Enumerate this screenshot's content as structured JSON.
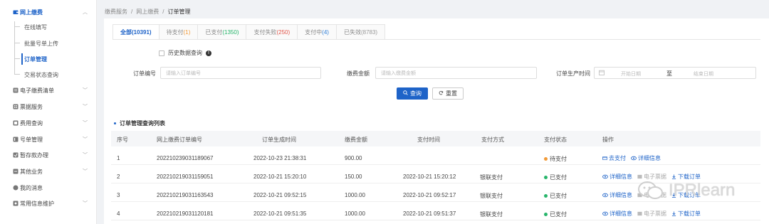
{
  "sidebar": {
    "items": [
      {
        "label": "网上缴费",
        "icon": "wallet-icon",
        "open": true
      },
      {
        "label": "电子缴费清单",
        "icon": "list-icon"
      },
      {
        "label": "票据服务",
        "icon": "receipt-icon"
      },
      {
        "label": "费用查询",
        "icon": "search-doc-icon"
      },
      {
        "label": "号单管理",
        "icon": "folder-icon"
      },
      {
        "label": "暂存款办理",
        "icon": "deposit-icon"
      },
      {
        "label": "其他业务",
        "icon": "grid-icon"
      },
      {
        "label": "我的消息",
        "icon": "bell-icon"
      },
      {
        "label": "常用信息维护",
        "icon": "settings-icon"
      }
    ],
    "subitems": [
      {
        "label": "在线填写"
      },
      {
        "label": "批量号单上传"
      },
      {
        "label": "订单管理",
        "active": true
      },
      {
        "label": "交易状态查询"
      }
    ]
  },
  "breadcrumb": {
    "items": [
      "缴费服务",
      "网上缴费",
      "订单管理"
    ],
    "separator": "/"
  },
  "tabs": [
    {
      "label": "全部",
      "count": "(10391)",
      "active": true,
      "color": "#1e63c8"
    },
    {
      "label": "待支付",
      "count": "(1)",
      "color": "#f19a38"
    },
    {
      "label": "已支付",
      "count": "(1350)",
      "color": "#27b56b"
    },
    {
      "label": "支付失败",
      "count": "(250)",
      "color": "#e2564b"
    },
    {
      "label": "支付中",
      "count": "(4)",
      "color": "#2f7fd8"
    },
    {
      "label": "已失效",
      "count": "(8783)",
      "color": "#999999"
    }
  ],
  "filters": {
    "history_label": "历史数据查询",
    "order_no_label": "订单编号",
    "order_no_placeholder": "请输入订单编号",
    "amount_label": "缴费金额",
    "amount_placeholder": "请输入缴费金额",
    "time_label": "订单生产时间",
    "start_placeholder": "开始日期",
    "to_label": "至",
    "end_placeholder": "结束日期",
    "query_button": "查询",
    "reset_button": "重置"
  },
  "table": {
    "title": "订单管理查询列表",
    "columns": [
      "序号",
      "网上缴费订单编号",
      "订单生成时间",
      "缴费金额",
      "支付时间",
      "支付方式",
      "支付状态",
      "操作"
    ],
    "rows": [
      {
        "index": "1",
        "order_no": "202210239031189067",
        "created": "2022-10-23 21:38:31",
        "amount": "900.00",
        "pay_time": "",
        "method": "",
        "status": "待支付",
        "status_color": "#f19a38",
        "ops": [
          "去支付",
          "详细信息"
        ]
      },
      {
        "index": "2",
        "order_no": "202210219031159051",
        "created": "2022-10-21 15:20:10",
        "amount": "150.00",
        "pay_time": "2022-10-21 15:20:12",
        "method": "银联支付",
        "status": "已支付",
        "status_color": "#27b56b",
        "ops": [
          "详细信息",
          "电子票据",
          "下载订单"
        ]
      },
      {
        "index": "3",
        "order_no": "202210219031163543",
        "created": "2022-10-21 09:52:15",
        "amount": "1000.00",
        "pay_time": "2022-10-21 09:52:17",
        "method": "银联支付",
        "status": "已支付",
        "status_color": "#27b56b",
        "ops": [
          "详细信息",
          "电子票据",
          "下载订单"
        ]
      },
      {
        "index": "4",
        "order_no": "202210219031120181",
        "created": "2022-10-21 09:51:35",
        "amount": "1000.00",
        "pay_time": "2022-10-21 09:51:37",
        "method": "银联支付",
        "status": "已支付",
        "status_color": "#27b56b",
        "ops": [
          "详细信息",
          "电子票据",
          "下载订单"
        ]
      }
    ]
  },
  "watermark": {
    "text": "IPRlearn",
    "icon": "wechat-icon"
  }
}
